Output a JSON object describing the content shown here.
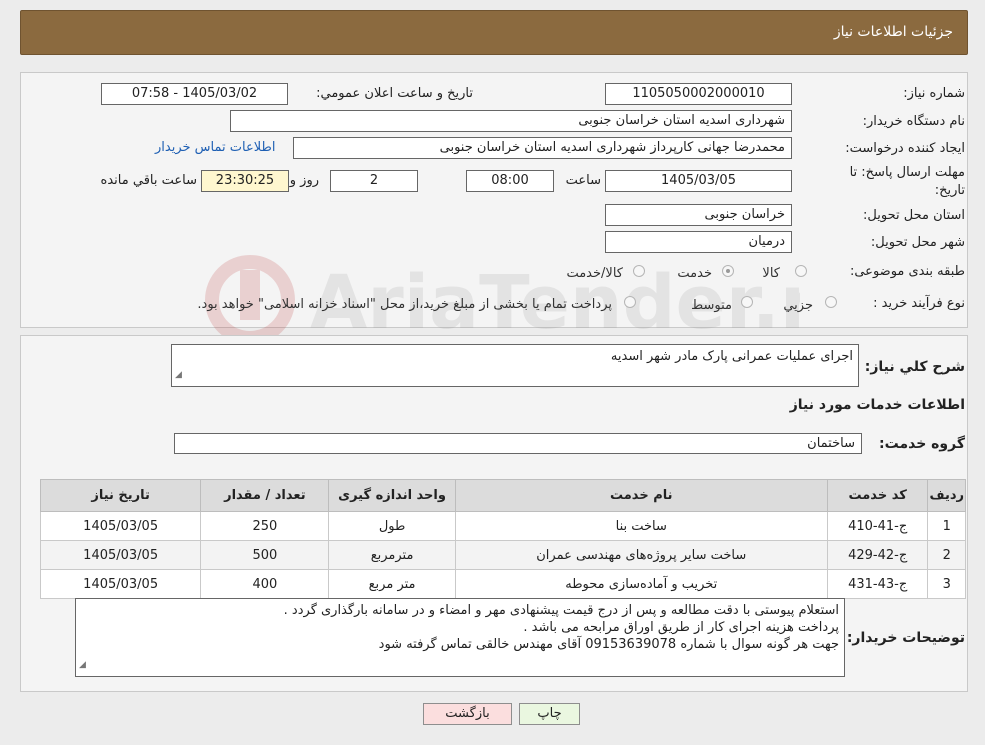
{
  "header": {
    "title": "جزئیات اطلاعات نیاز"
  },
  "watermark": {
    "text": "AriaTender.neT"
  },
  "fields": {
    "need_number_label": "شماره نیاز:",
    "need_number": "1105050002000010",
    "announce_label": "تاریخ و ساعت اعلان عمومي:",
    "announce_value": "1405/03/02 - 07:58",
    "buyer_label": "نام دستگاه خریدار:",
    "buyer_value": "شهرداری اسدیه استان خراسان جنوبی",
    "creator_label": "ایجاد کننده درخواست:",
    "creator_value": "محمدرضا جهانی کارپرداز شهرداری اسدیه استان خراسان جنوبی",
    "contact_link": "اطلاعات تماس خریدار",
    "deadline_label_1": "مهلت ارسال پاسخ: تا",
    "deadline_label_2": "تاریخ:",
    "deadline_date": "1405/03/05",
    "time_label": "ساعت",
    "deadline_time": "08:00",
    "days_value": "2",
    "days_label": "روز و",
    "remaining_value": "23:30:25",
    "remaining_label": "ساعت باقي مانده",
    "province_label": "استان محل تحویل:",
    "province_value": "خراسان جنوبی",
    "city_label": "شهر محل تحویل:",
    "city_value": "درمیان",
    "category_label": "طبقه بندی موضوعی:",
    "category_options": [
      "کالا",
      "خدمت",
      "کالا/خدمت"
    ],
    "category_selected": "خدمت",
    "process_label": "نوع فرآیند خرید :",
    "process_options": [
      "جزیي",
      "متوسط"
    ],
    "process_note": "پرداخت تمام یا بخشی از مبلغ خرید،از محل \"اسناد خزانه اسلامی\" خواهد بود."
  },
  "summary": {
    "label": "شرح کلي نیاز:",
    "value": "اجرای عملیات عمرانی پارک مادر شهر اسدیه"
  },
  "services_section": {
    "title": "اطلاعات خدمات مورد نیاز",
    "group_label": "گروه خدمت:",
    "group_value": "ساختمان"
  },
  "table": {
    "columns": [
      "ردیف",
      "کد خدمت",
      "نام خدمت",
      "واحد اندازه گیری",
      "تعداد / مقدار",
      "تاریخ نیاز"
    ],
    "rows": [
      [
        "1",
        "ج-41-410",
        "ساخت بنا",
        "طول",
        "250",
        "1405/03/05"
      ],
      [
        "2",
        "ج-42-429",
        "ساخت سایر پروژه‌های مهندسی عمران",
        "مترمربع",
        "500",
        "1405/03/05"
      ],
      [
        "3",
        "ج-43-431",
        "تخریب و آماده‌سازی محوطه",
        "متر مربع",
        "400",
        "1405/03/05"
      ]
    ]
  },
  "buyer_notes": {
    "label": "توضیحات خریدار:",
    "lines": [
      "استعلام پیوستی با دقت مطالعه و پس از درج قیمت پیشنهادی مهر و امضاء و در سامانه بارگذاری گردد .",
      "پرداخت هزینه اجرای کار از طریق اوراق مرابحه می باشد .",
      "جهت هر گونه سوال با شماره 09153639078 آقای مهندس خالقی تماس گرفته شود"
    ]
  },
  "buttons": {
    "print": "چاپ",
    "back": "بازگشت"
  },
  "colors": {
    "header": "#8b6a3f",
    "print_button": "#eaf7e0",
    "back_button": "#fbdede",
    "link": "#1e5fb3"
  }
}
